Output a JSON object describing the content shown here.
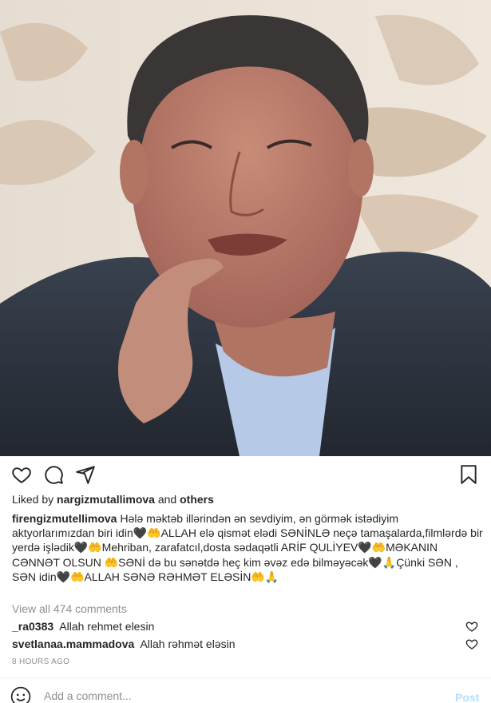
{
  "post": {
    "photo_alt": "post photo",
    "liked_by_prefix": "Liked by",
    "liked_by_user": "nargizmutallimova",
    "liked_by_and": "and",
    "liked_by_others": "others",
    "caption_user": "firengizmutellimova",
    "caption_text": "Hələ məktəb illərindən ən sevdiyim, ən görmək istədiyim aktyorlarımızdan biri idin🖤🤲ALLAH elə qismət elədi SƏNİNLƏ neçə tamaşalarda,filmlərdə bir yerdə işlədik🖤🤲Mehriban, zarafatcıl,dosta sədaqətli ARİF QULİYEV🖤🤲MƏKANIN CƏNNƏT OLSUN 🤲SƏNİ də bu sənətdə heç kim əvəz edə bilməyəcək🖤🙏Çünki SƏN , SƏN idin🖤🤲ALLAH SƏNƏ RƏHMƏT ELƏSİN🤲🙏",
    "view_all_comments": "View all 474 comments",
    "comments": [
      {
        "user": "_ra0383",
        "text": "Allah rehmet elesin"
      },
      {
        "user": "svetlanaa.mammadova",
        "text": "Allah rəhmət eləsin"
      }
    ],
    "timestamp": "8 HOURS AGO"
  },
  "actions": {
    "like_icon": "heart-outline-icon",
    "comment_icon": "comment-bubble-icon",
    "share_icon": "paper-plane-icon",
    "save_icon": "bookmark-icon"
  },
  "add_comment": {
    "placeholder": "Add a comment...",
    "post_label": "Post",
    "emoji_icon": "smiley-icon"
  },
  "colors": {
    "text": "#262626",
    "muted": "#8e8e8e",
    "post_disabled": "#b2dffc",
    "divider": "#efefef"
  }
}
